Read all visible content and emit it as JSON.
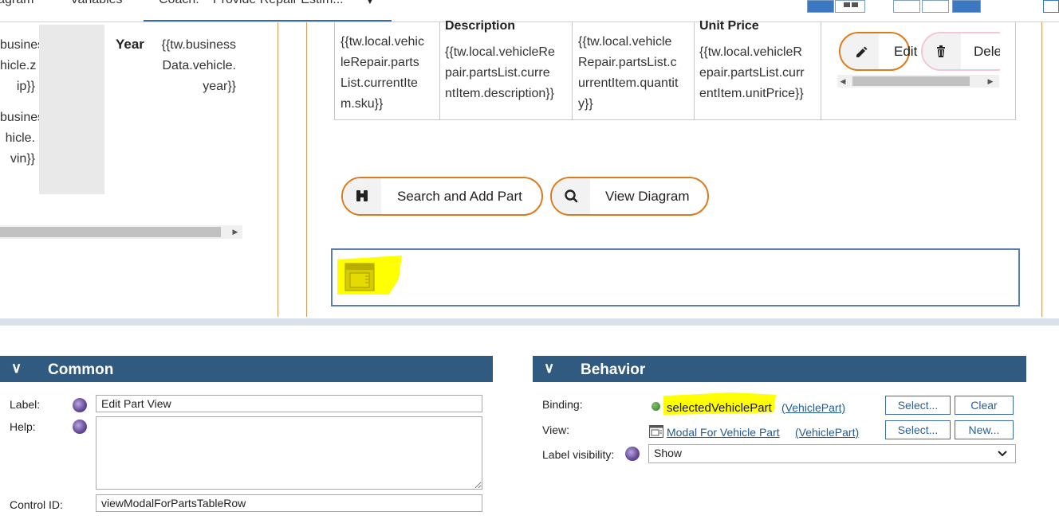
{
  "tabs": [
    {
      "label": "Diagram"
    },
    {
      "label": "Variables"
    },
    {
      "label": "Coach:",
      "detail": "Provide Repair Estim..."
    }
  ],
  "canvas": {
    "left_column": {
      "zip_lines": [
        "business",
        "hicle.z",
        "ip}}"
      ],
      "vin_lines": [
        "business",
        "hicle.",
        "vin}}"
      ],
      "year_label": "Year",
      "year_lines": [
        "{{tw.business",
        "Data.vehicle.",
        "year}}"
      ]
    },
    "table": {
      "headers": [
        "Description",
        "Unit Price"
      ],
      "cells": [
        [
          "{{tw.local.vehic",
          "leRepair.parts",
          "List.currentIte",
          "m.sku}}"
        ],
        [
          "{{tw.local.vehicleRe",
          "pair.partsList.curre",
          "ntItem.description}}"
        ],
        [
          "{{tw.local.vehicle",
          "Repair.partsList.c",
          "urrentItem.quantit",
          "y}}"
        ],
        [
          "{{tw.local.vehicleR",
          "epair.partsList.curr",
          "entItem.unitPrice}}"
        ]
      ],
      "edit_label": "Edit",
      "delete_label": "Dele"
    },
    "buttons": {
      "search_add_label": "Search and Add Part",
      "view_diagram_label": "View Diagram"
    }
  },
  "common_panel": {
    "title": "Common",
    "label_label": "Label:",
    "label_value": "Edit Part View",
    "help_label": "Help:",
    "help_value": "",
    "control_id_label": "Control ID:",
    "control_id_value": "viewModalForPartsTableRow"
  },
  "behavior_panel": {
    "title": "Behavior",
    "binding_label": "Binding:",
    "binding_value": "selectedVehiclePart",
    "binding_type": "(VehiclePart)",
    "view_label": "View:",
    "view_value": "Modal For Vehicle Part",
    "view_type": "(VehiclePart)",
    "label_visibility_label": "Label visibility:",
    "label_visibility_value": "Show",
    "select_label": "Select...",
    "clear_label": "Clear",
    "new_label": "New..."
  },
  "colors": {
    "accent_orange": "#dc7b1c",
    "panel_header": "#305a80",
    "highlight": "#ffff00",
    "link": "#1e5b96"
  }
}
